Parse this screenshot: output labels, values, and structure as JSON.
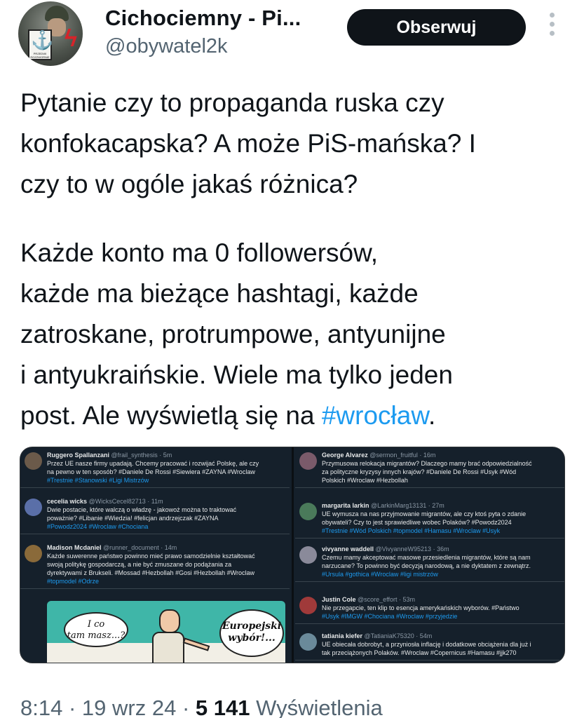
{
  "author": {
    "display_name": "Cichociemny - Pi...",
    "handle": "@obywatel2k",
    "avatar_badge_text": "PRZEDWI ROZZWORNIE"
  },
  "follow_button_label": "Obserwuj",
  "tweet": {
    "paragraph1": [
      "Pytanie czy to propaganda ruska czy",
      "konfokacapska? A może PiS-mańska? I",
      "czy to w ogóle jakaś różnica?"
    ],
    "paragraph2": [
      "Każde konto ma 0 followersów,",
      "każde ma bieżące hashtagi, każde",
      "zatroskane, protrumpowe, antyunijne",
      "i antyukraińskie. Wiele ma tylko jeden"
    ],
    "last_line_prefix": "post. Ale wyświetlą się na ",
    "last_line_hashtag": "#wrocław",
    "last_line_suffix": "."
  },
  "embedded_screenshot": {
    "left_column": [
      {
        "name": "Ruggero Spallanzani",
        "meta": "@frail_synthesis · 5m",
        "avatar_color": "#6b5a4a",
        "lines": [
          "Przez UE nasze firmy upadają. Chcemy pracować i rozwijać Polskę, ale czy",
          "na pewno w ten sposób? #Daniele De Rossi #Siewiera #ZAYNA #Wroclaw"
        ],
        "tags": "#Trestnie #Stanowski #Ligi Mistrzów"
      },
      {
        "name": "cecelia wicks",
        "meta": "@WicksCecel82713 · 11m",
        "avatar_color": "#5a6fa8",
        "lines": [
          "Dwie postacie, które walczą o władzę - jakowoż można to traktować",
          "poważnie? #Libanie #Wiedzia! #felicjan andrzejczak #ZAYNA"
        ],
        "tags": "#Powodz2024 #Wroclaw #Chociana"
      },
      {
        "name": "Madison Mcdaniel",
        "meta": "@runner_document · 14m",
        "avatar_color": "#8a6a3a",
        "lines": [
          "Każde suwerenne państwo powinno mieć prawo samodzielnie kształtować",
          "swoją politykę gospodarczą, a nie być zmuszane do podążania za",
          "dyrektywami z Brukseli. #Mossad #Hezbollah #Gosi #Hezbollah #Wroclaw"
        ],
        "tags": "#topmodel #Odrze"
      }
    ],
    "cartoon": {
      "bubble_left_line1": "I co",
      "bubble_left_line2": "tam masz...?",
      "bubble_right_line1": "Europejski",
      "bubble_right_line2": "wybór!..."
    },
    "right_column": [
      {
        "name": "George Alvarez",
        "meta": "@sermon_fruitful · 16m",
        "avatar_color": "#7a5a6a",
        "lines": [
          "Przymusowa relokacja migrantów? Dlaczego mamy brać odpowiedzialność",
          "za polityczne kryzysy innych krajów? #Daniele De Rossi #Usyk #Wód",
          "Polskich #Wroclaw #Hezbollah"
        ],
        "tags": ""
      },
      {
        "name": "margarita larkin",
        "meta": "@LarkinMarg13131 · 27m",
        "avatar_color": "#4a7a5a",
        "lines": [
          "UE wymusza na nas przyjmowanie migrantów, ale czy ktoś pyta o zdanie",
          "obywateli? Czy to jest sprawiedliwe wobec Polaków? #Powodz2024"
        ],
        "tags": "#Trestnie #Wód Polskich #topmodel #Hamasu #Wroclaw #Usyk"
      },
      {
        "name": "vivyanne waddell",
        "meta": "@VivyanneW95213 · 36m",
        "avatar_color": "#8a8a9a",
        "lines": [
          "Czemu mamy akceptować masowe przesiedlenia migrantów, które są nam",
          "narzucane? To powinno być decyzją narodową, a nie dyktatem z zewnątrz."
        ],
        "tags": "#Ursula #gothica #Wroclaw #ligi mistrzów"
      },
      {
        "name": "Justin Cole",
        "meta": "@score_effort · 53m",
        "avatar_color": "#a03a3a",
        "lines": [
          "Nie przegapcie, ten klip to esencja amerykańskich wyborów. #Państwo"
        ],
        "tags": "#Usyk #IMGW #Chociana #Wroclaw #przyjedzie"
      },
      {
        "name": "tatiania kiefer",
        "meta": "@TatianiaK75320 · 54m",
        "avatar_color": "#6a8a9a",
        "lines": [
          "UE obiecała dobrobyt, a przyniosła inflację i dodatkowe obciążenia dla już i",
          "tak przeciążonych Polaków. #Wroclaw #Copernicus #Hamasu #jjk270"
        ],
        "tags": ""
      }
    ]
  },
  "meta": {
    "time": "8:14",
    "date": "19 wrz 24",
    "views_count": "5 141",
    "views_label": "Wyświetlenia",
    "separator": "·"
  },
  "icons": {
    "more": "more-vertical-icon"
  }
}
